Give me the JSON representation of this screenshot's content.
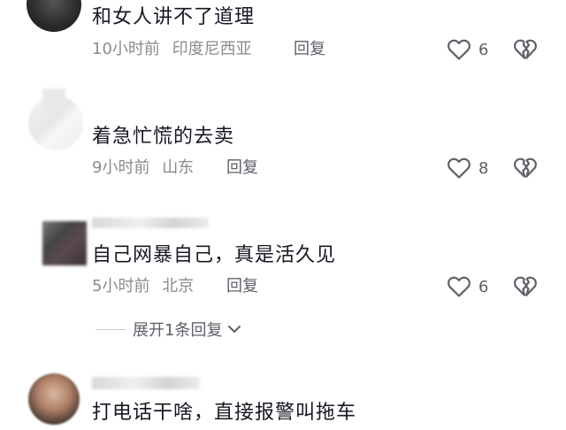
{
  "comments": [
    {
      "text": "和女人讲不了道理",
      "time": "10小时前",
      "location": "印度尼西亚",
      "reply_label": "回复",
      "likes": "6"
    },
    {
      "text": "着急忙慌的去卖",
      "time": "9小时前",
      "location": "山东",
      "reply_label": "回复",
      "likes": "8"
    },
    {
      "text": "自己网暴自己，真是活久见",
      "time": "5小时前",
      "location": "北京",
      "reply_label": "回复",
      "likes": "6"
    },
    {
      "text": "打电话干啥，直接报警叫拖车"
    }
  ],
  "expand_replies_label": "展开1条回复",
  "colors": {
    "text": "#161823",
    "meta": "#8a8b91",
    "action": "#5e6068"
  },
  "icons": [
    "heart-outline-icon",
    "broken-heart-icon",
    "chevron-down-icon"
  ]
}
